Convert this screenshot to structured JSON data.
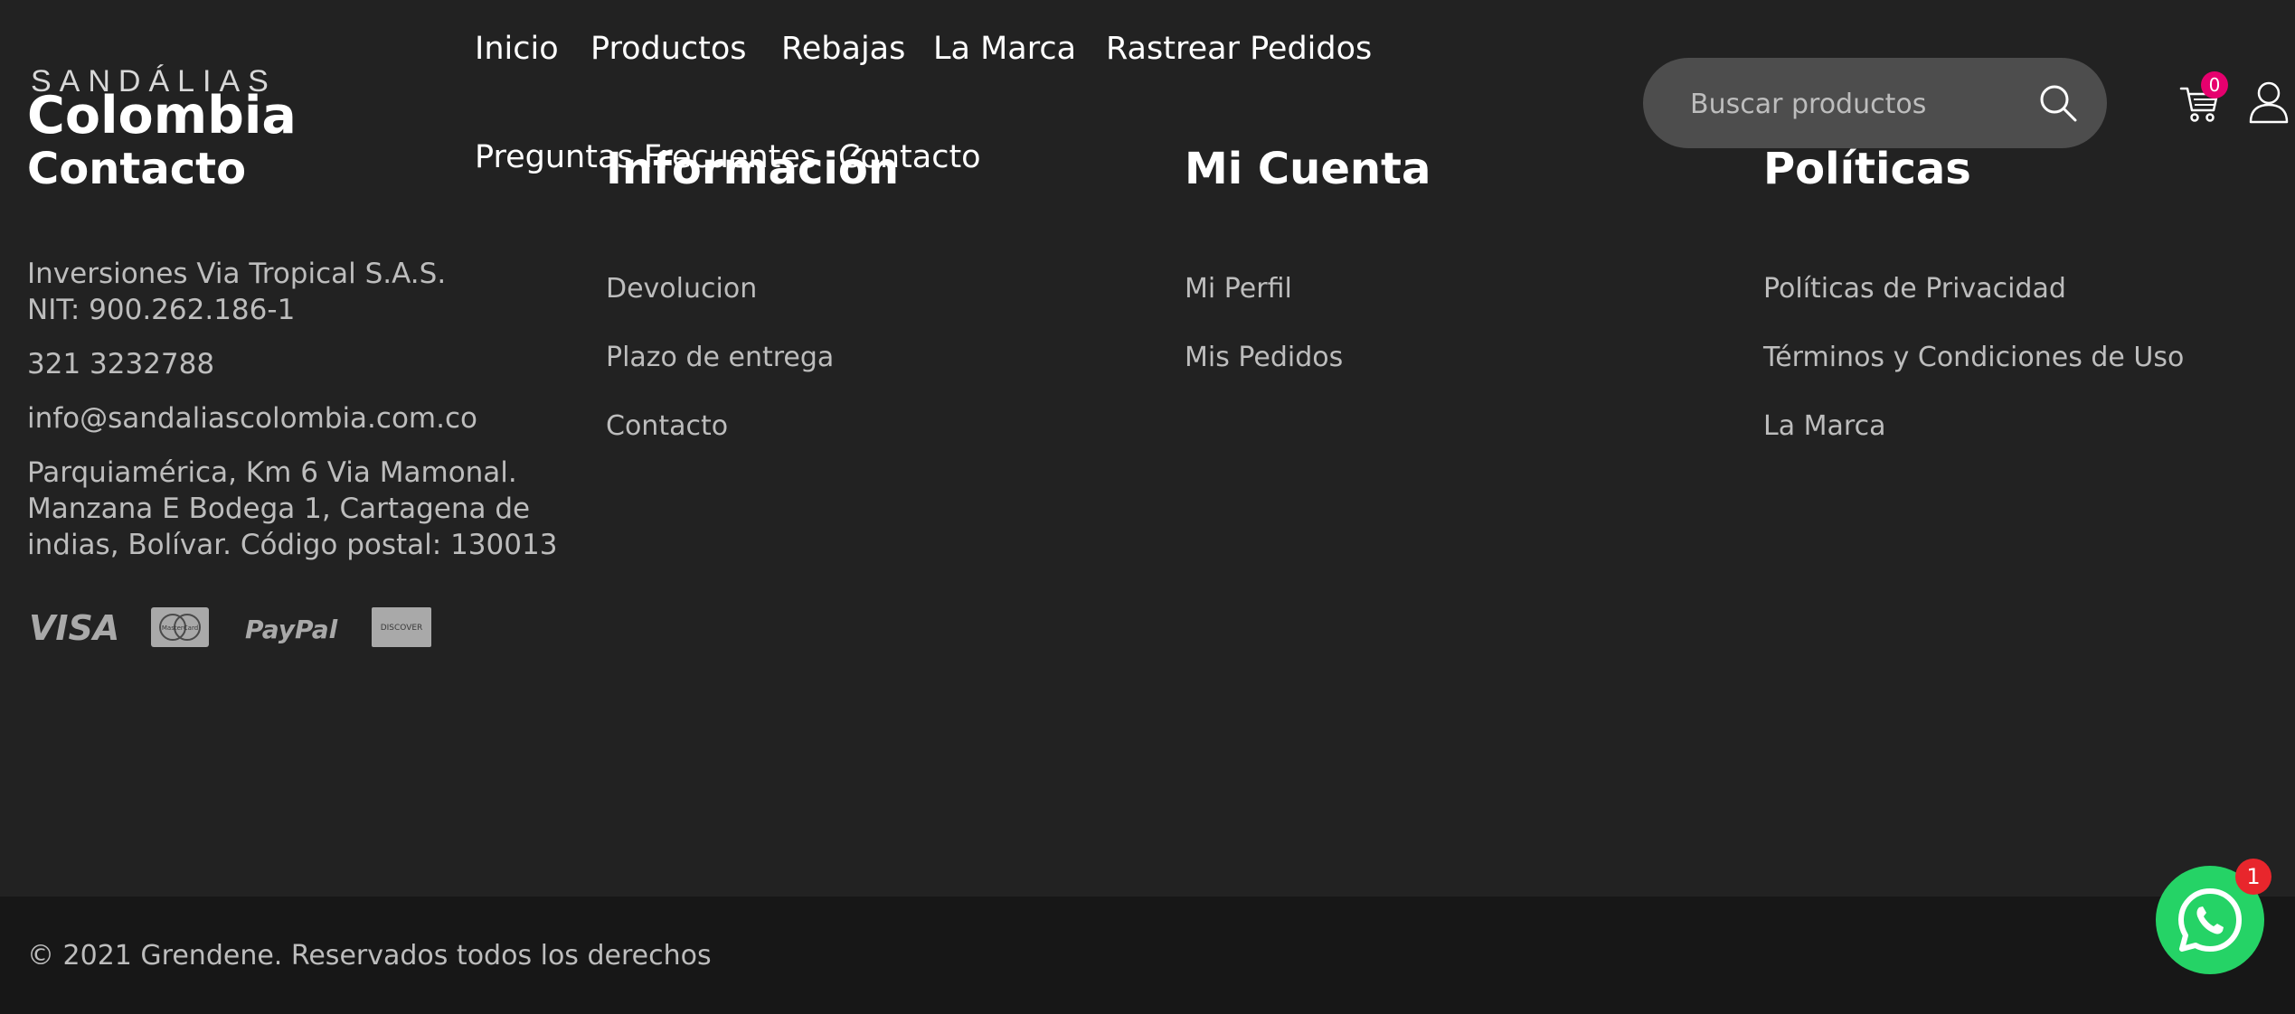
{
  "logo": {
    "top": "SANDÁLIAS",
    "main": "Colombia"
  },
  "nav": {
    "items": [
      "Inicio",
      "Productos",
      "Rebajas",
      "La Marca",
      "Rastrear Pedidos",
      "Preguntas Frecuentes",
      "Contacto"
    ]
  },
  "search": {
    "placeholder": "Buscar productos"
  },
  "cart": {
    "count": "0"
  },
  "sections": {
    "contacto": {
      "title": "Contacto",
      "company": "Inversiones Via Tropical S.A.S.",
      "nit": "NIT: 900.262.186-1",
      "phone": "321 3232788",
      "email": "info@sandaliascolombia.com.co",
      "address": [
        "Parquiamérica, Km 6 Via Mamonal.",
        "Manzana E Bodega 1, Cartagena de",
        "indias, Bolívar. Código postal: 130013"
      ]
    },
    "informacion": {
      "title": "Información",
      "links": [
        "Devolucion",
        "Plazo de entrega",
        "Contacto"
      ]
    },
    "mi_cuenta": {
      "title": "Mi Cuenta",
      "links": [
        "Mi Perfil",
        "Mis Pedidos"
      ]
    },
    "politicas": {
      "title": "Políticas",
      "links": [
        "Políticas de Privacidad",
        "Términos y Condiciones de Uso",
        "La Marca"
      ]
    }
  },
  "payments": [
    "VISA",
    "MasterCard",
    "PayPal",
    "DISCOVER"
  ],
  "footer": {
    "copyright": "© 2021 Grendene. Reservados todos los derechos"
  },
  "whatsapp": {
    "badge": "1"
  },
  "colors": {
    "background": "#222222",
    "footer": "#171717",
    "cart_badge": "#e6006e",
    "whatsapp": "#25d366"
  }
}
